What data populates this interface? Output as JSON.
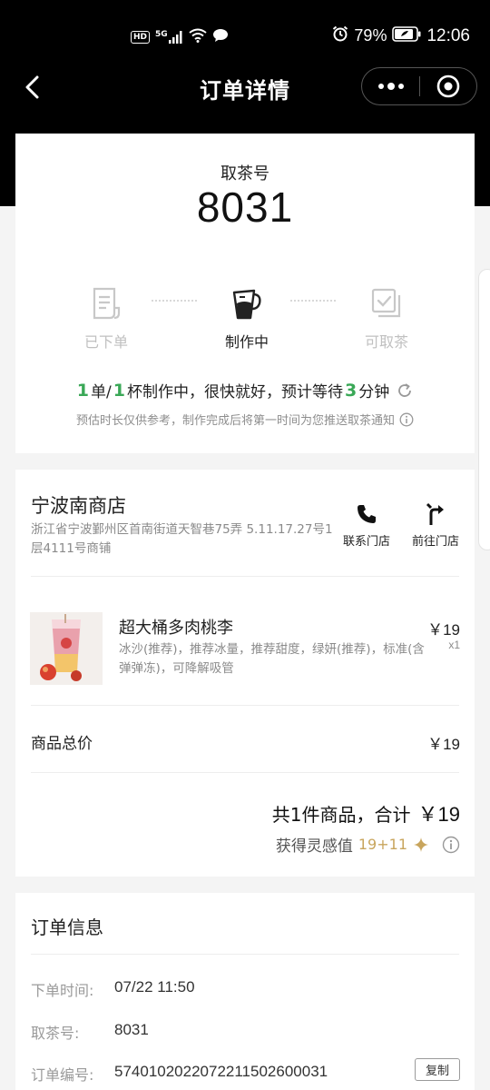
{
  "status_bar": {
    "hd": "HD",
    "signal": "5G",
    "battery_pct": "79%",
    "time": "12:06"
  },
  "navbar": {
    "title": "订单详情"
  },
  "pickup": {
    "label": "取茶号",
    "number": "8031",
    "steps": [
      {
        "label": "已下单",
        "state": "done",
        "icon": "receipt-icon"
      },
      {
        "label": "制作中",
        "state": "active",
        "icon": "measuring-cup-icon"
      },
      {
        "label": "可取茶",
        "state": "pending",
        "icon": "checkbox-icon"
      }
    ],
    "wait": {
      "orders": "1",
      "t1": "单/",
      "cups": "1",
      "t2": "杯制作中，很快就好，预计等待",
      "minutes": "3",
      "t3": "分钟"
    },
    "note": "预估时长仅供参考，制作完成后将第一时间为您推送取茶通知"
  },
  "store": {
    "name": "宁波南商店",
    "address": "浙江省宁波鄞州区首南街道天智巷75弄 5.11.17.27号1层4111号商铺",
    "call_label": "联系门店",
    "nav_label": "前往门店"
  },
  "product": {
    "name": "超大桶多肉桃李",
    "options": "冰沙(推荐)，推荐冰量，推荐甜度，绿妍(推荐)，标准(含弹弹冻)，可降解吸管",
    "price": "￥19",
    "qty": "x1"
  },
  "totals": {
    "goods_label": "商品总价",
    "goods_value": "￥19",
    "summary": "共1件商品，合计",
    "summary_amount": "￥19",
    "inspiration_label": "获得灵感值",
    "inspiration_value": "19+11"
  },
  "order_info": {
    "title": "订单信息",
    "rows": [
      {
        "key": "下单时间:",
        "value": "07/22 11:50"
      },
      {
        "key": "取茶号:",
        "value": "8031"
      },
      {
        "key": "订单编号:",
        "value": "5740102022072211502600031"
      }
    ],
    "copy_label": "复制"
  },
  "colors": {
    "accent_green": "#3aa857",
    "gold": "#c8a55d",
    "header_bg": "#000000"
  }
}
